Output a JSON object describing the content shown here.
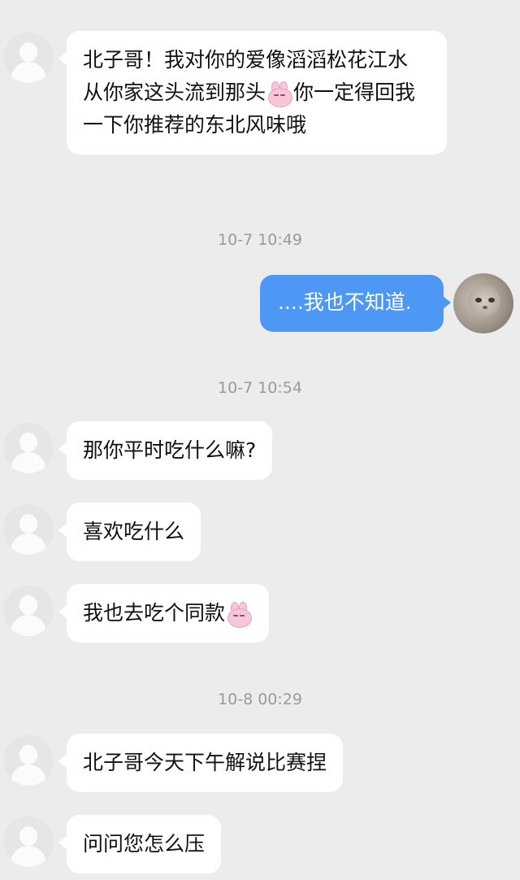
{
  "messages": [
    {
      "id": "m1",
      "side": "left",
      "text_parts": [
        "北子哥！我对你的爱像滔滔松花江水 从你家这头流到那头",
        "你一定得回我一下你推荐的东北风味哦"
      ],
      "emoji_after_part_1": "bunny-emoji"
    },
    {
      "id": "t1",
      "timestamp": "10-7 10:49"
    },
    {
      "id": "m2",
      "side": "right",
      "text": "....我也不知道."
    },
    {
      "id": "t2",
      "timestamp": "10-7 10:54"
    },
    {
      "id": "m3",
      "side": "left",
      "text": "那你平时吃什么嘛?"
    },
    {
      "id": "m4",
      "side": "left",
      "text": "喜欢吃什么"
    },
    {
      "id": "m5",
      "side": "left",
      "text": "我也去吃个同款",
      "emoji_after": "bunny-emoji"
    },
    {
      "id": "t3",
      "timestamp": "10-8 00:29"
    },
    {
      "id": "m6",
      "side": "left",
      "text": "北子哥今天下午解说比赛捏"
    },
    {
      "id": "m7",
      "side": "left",
      "text": "问问您怎么压"
    }
  ],
  "colors": {
    "background": "#ececec",
    "incoming_bubble": "#ffffff",
    "outgoing_bubble": "#4d97f5",
    "timestamp": "#9a9a9a"
  }
}
